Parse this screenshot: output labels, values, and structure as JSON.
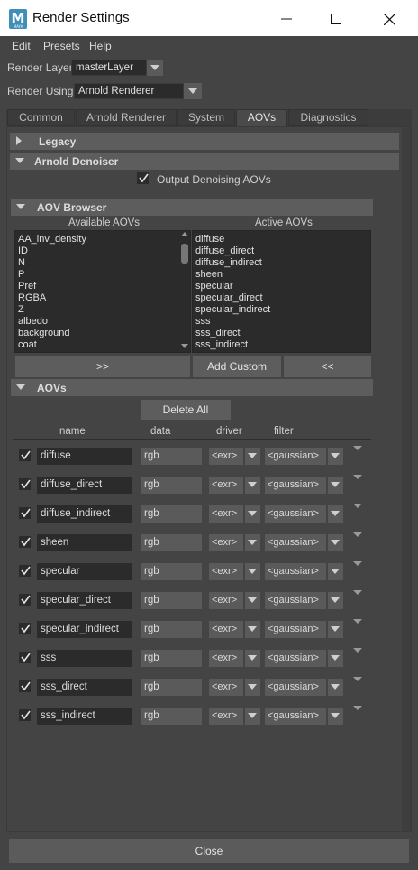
{
  "window": {
    "title": "Render Settings",
    "logo_letter": "M",
    "logo_sub": "MAYA"
  },
  "menu": [
    "Edit",
    "Presets",
    "Help"
  ],
  "render_layer": {
    "label": "Render Layer",
    "value": "masterLayer"
  },
  "render_using": {
    "label": "Render Using",
    "value": "Arnold Renderer"
  },
  "tabs": [
    "Common",
    "Arnold Renderer",
    "System",
    "AOVs",
    "Diagnostics"
  ],
  "active_tab": "AOVs",
  "sections": {
    "legacy": "Legacy",
    "denoiser": "Arnold Denoiser",
    "output_denoising": "Output Denoising AOVs",
    "aov_browser": "AOV Browser",
    "aovs": "AOVs"
  },
  "browser": {
    "available_header": "Available AOVs",
    "active_header": "Active AOVs",
    "available": [
      "AA_inv_density",
      "ID",
      "N",
      "P",
      "Pref",
      "RGBA",
      "Z",
      "albedo",
      "background",
      "coat"
    ],
    "active": [
      "diffuse",
      "diffuse_direct",
      "diffuse_indirect",
      "sheen",
      "specular",
      "specular_direct",
      "specular_indirect",
      "sss",
      "sss_direct",
      "sss_indirect"
    ],
    "add_button": ">>",
    "add_custom_button": "Add Custom",
    "remove_button": "<<"
  },
  "aov_table": {
    "delete_all": "Delete All",
    "columns": [
      "name",
      "data",
      "driver",
      "filter"
    ],
    "rows": [
      {
        "name": "diffuse",
        "data": "rgb",
        "driver": "<exr>",
        "filter": "<gaussian>"
      },
      {
        "name": "diffuse_direct",
        "data": "rgb",
        "driver": "<exr>",
        "filter": "<gaussian>"
      },
      {
        "name": "diffuse_indirect",
        "data": "rgb",
        "driver": "<exr>",
        "filter": "<gaussian>"
      },
      {
        "name": "sheen",
        "data": "rgb",
        "driver": "<exr>",
        "filter": "<gaussian>"
      },
      {
        "name": "specular",
        "data": "rgb",
        "driver": "<exr>",
        "filter": "<gaussian>"
      },
      {
        "name": "specular_direct",
        "data": "rgb",
        "driver": "<exr>",
        "filter": "<gaussian>"
      },
      {
        "name": "specular_indirect",
        "data": "rgb",
        "driver": "<exr>",
        "filter": "<gaussian>"
      },
      {
        "name": "sss",
        "data": "rgb",
        "driver": "<exr>",
        "filter": "<gaussian>"
      },
      {
        "name": "sss_direct",
        "data": "rgb",
        "driver": "<exr>",
        "filter": "<gaussian>"
      },
      {
        "name": "sss_indirect",
        "data": "rgb",
        "driver": "<exr>",
        "filter": "<gaussian>"
      }
    ]
  },
  "close_button": "Close"
}
